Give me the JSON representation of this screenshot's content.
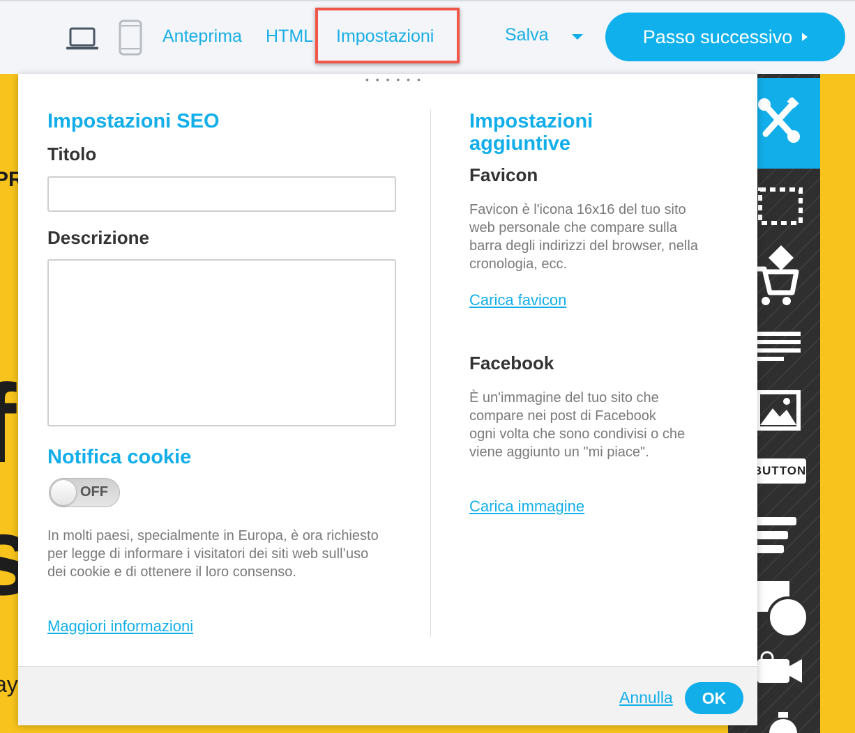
{
  "toolbar": {
    "desktop_icon": "laptop-icon",
    "mobile_icon": "phone-icon",
    "preview_label": "Anteprima",
    "html_label": "HTML",
    "settings_label": "Impostazioni",
    "save_label": "Salva",
    "next_label": "Passo successivo",
    "accent_color": "#12aeea",
    "highlight_color": "#f0574a"
  },
  "background": {
    "text_pr": "PR",
    "text_f": "f",
    "text_s": "s",
    "text_ay": "ay",
    "text_ex": "!"
  },
  "tools": {
    "settings_icon": "tools-icon",
    "section_icon": "section-icon",
    "shop_icon": "cart-icon",
    "text_icon": "text-icon",
    "image_icon": "image-icon",
    "button_label": "BUTTON",
    "form_icon": "form-icon",
    "shapes_icon": "shapes-icon",
    "video_icon": "video-icon",
    "timer_icon": "timer-icon"
  },
  "modal": {
    "seo": {
      "heading": "Impostazioni SEO",
      "title_label": "Titolo",
      "title_value": "",
      "description_label": "Descrizione",
      "description_value": ""
    },
    "cookie": {
      "heading": "Notifica cookie",
      "toggle_state": "OFF",
      "text": "In molti paesi, specialmente in Europa, è ora richiesto per legge di informare i visitatori dei siti web sull’uso dei cookie e di ottenere il loro consenso.",
      "link": "Maggiori informazioni"
    },
    "additional": {
      "heading": "Impostazioni aggiuntive",
      "favicon_heading": "Favicon",
      "favicon_text": "Favicon è l'icona 16x16 del tuo sito web personale che compare sulla barra degli indirizzi del browser, nella cronologia, ecc.",
      "favicon_link": "Carica favicon",
      "facebook_heading": "Facebook",
      "facebook_text": "È un'immagine del tuo sito che compare nei post di Facebook ogni volta che sono condivisi o che viene aggiunto un \"mi piace\".",
      "facebook_link": "Carica immagine"
    },
    "footer": {
      "cancel_label": "Annulla",
      "ok_label": "OK"
    }
  }
}
